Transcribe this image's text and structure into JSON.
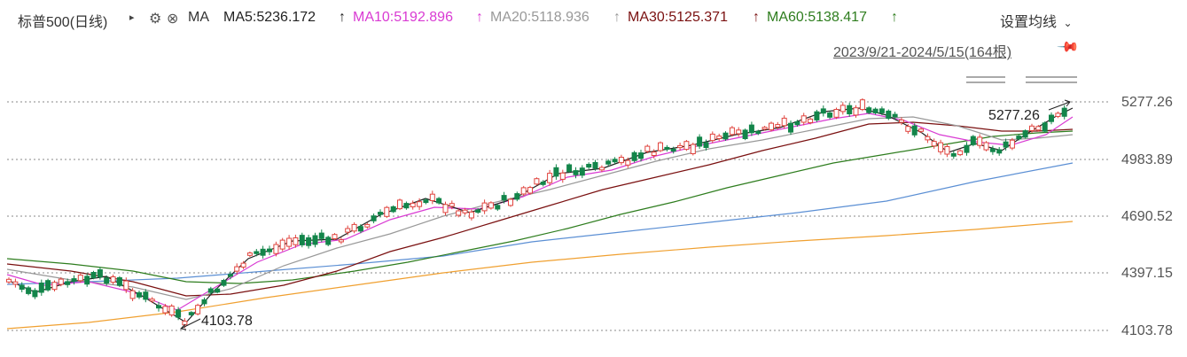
{
  "header": {
    "title": "标普500(日线)",
    "indicator": "MA",
    "ma5": "MA5:5236.172",
    "ma10": "MA10:5192.896",
    "ma20": "MA20:5118.936",
    "ma30": "MA30:5125.371",
    "ma60": "MA60:5138.417",
    "settings_label": "设置均线",
    "date_range": "2023/9/21-2024/5/15(164根)"
  },
  "colors": {
    "ma5": "#222222",
    "ma10": "#d93bd3",
    "ma20": "#999999",
    "ma30": "#7a1010",
    "ma60": "#2e7d1e",
    "ma120": "#5b8fd4",
    "ma250": "#f0a030",
    "up": "#e0443e",
    "down": "#13854a"
  },
  "chart_data": {
    "type": "candlestick",
    "y_ticks": [
      "5277.26",
      "4983.89",
      "4690.52",
      "4397.15",
      "4103.78"
    ],
    "ylim": [
      4103.78,
      5277.26
    ],
    "annotations": {
      "high": "5277.26",
      "low": "4103.78"
    },
    "series": [
      {
        "name": "MA5",
        "last": 5236.172
      },
      {
        "name": "MA10",
        "last": 5192.896
      },
      {
        "name": "MA20",
        "last": 5118.936
      },
      {
        "name": "MA30",
        "last": 5125.371
      },
      {
        "name": "MA60",
        "last": 5138.417
      }
    ]
  }
}
